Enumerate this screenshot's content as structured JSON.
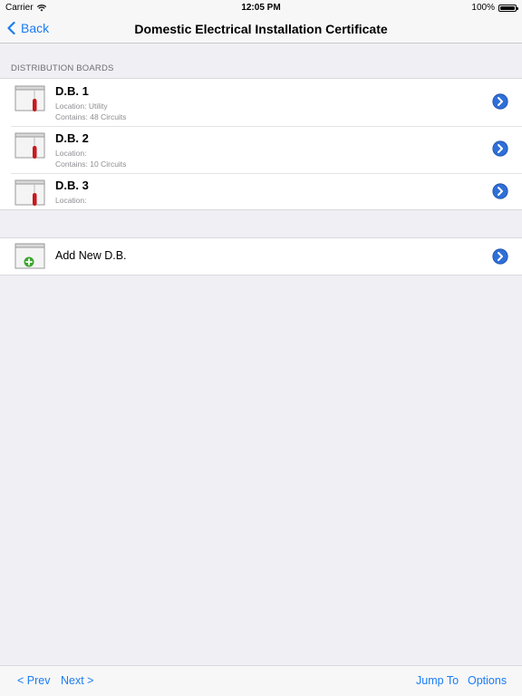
{
  "status_bar": {
    "carrier": "Carrier",
    "time": "12:05 PM",
    "battery": "100%"
  },
  "nav": {
    "back_label": "Back",
    "title": "Domestic Electrical Installation Certificate"
  },
  "section": {
    "header": "DISTRIBUTION BOARDS"
  },
  "boards": [
    {
      "title": "D.B. 1",
      "location": "Location: Utility",
      "contains": "Contains: 48 Circuits"
    },
    {
      "title": "D.B. 2",
      "location": "Location:",
      "contains": "Contains: 10 Circuits"
    },
    {
      "title": "D.B. 3",
      "location": "Location:"
    }
  ],
  "add": {
    "label": "Add New D.B."
  },
  "toolbar": {
    "prev": "<  Prev",
    "next": "Next  >",
    "jump_to": "Jump To",
    "options": "Options"
  },
  "colors": {
    "accent": "#1a7cf5",
    "disclosure": "#2f6fd8",
    "board_red": "#c8181e",
    "add_green": "#3aa62d"
  }
}
